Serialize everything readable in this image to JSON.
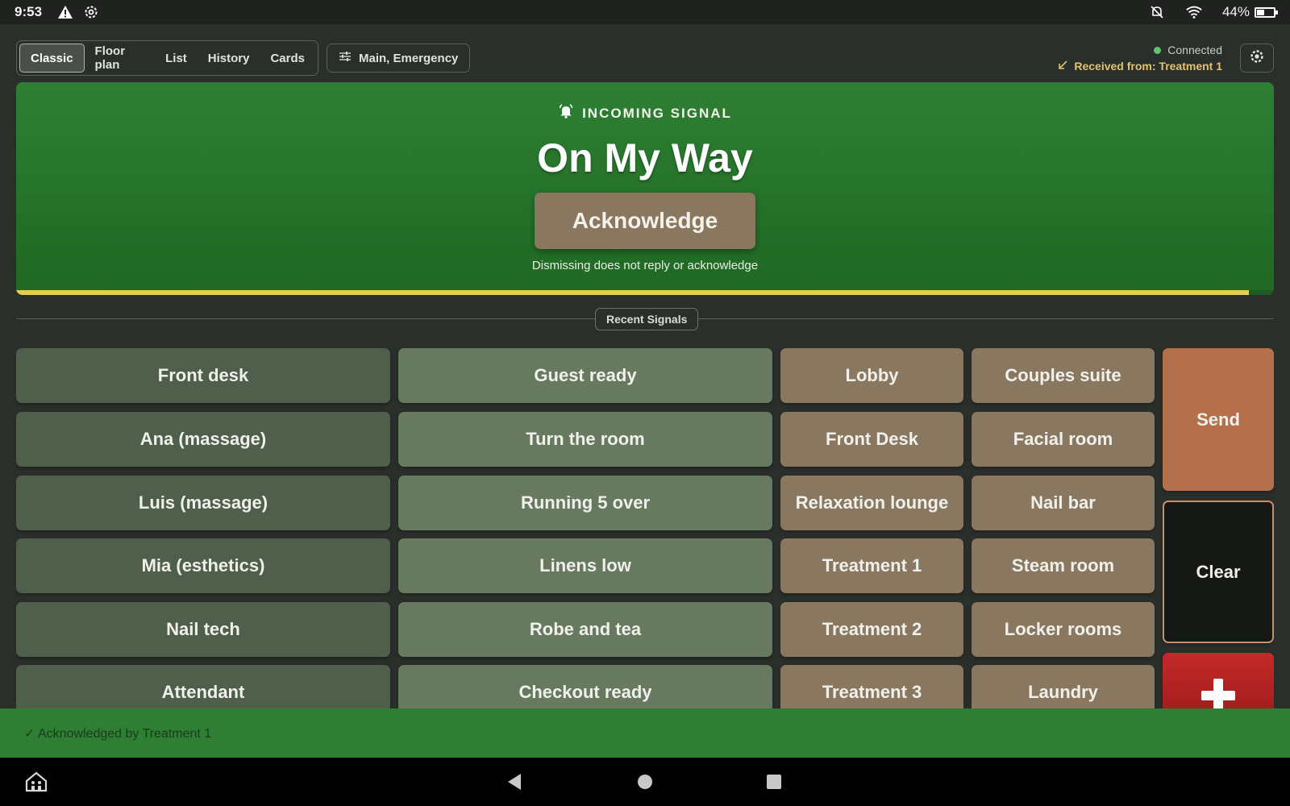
{
  "status_bar": {
    "time": "9:53",
    "battery": "44%",
    "battery_level": 0.44
  },
  "toolbar": {
    "tabs": [
      {
        "label": "Classic",
        "active": true
      },
      {
        "label": "Floor plan",
        "active": false
      },
      {
        "label": "List",
        "active": false
      },
      {
        "label": "History",
        "active": false
      },
      {
        "label": "Cards",
        "active": false
      }
    ],
    "filter_label": "Main, Emergency",
    "connection_status": "Connected",
    "received_from": "Received from: Treatment 1"
  },
  "banner": {
    "kicker": "INCOMING SIGNAL",
    "headline": "On My Way",
    "acknowledge_label": "Acknowledge",
    "note": "Dismissing does not reply or acknowledge",
    "progress": 0.98
  },
  "recent_signals_label": "Recent Signals",
  "grid": {
    "recipients": [
      "Front desk",
      "Ana (massage)",
      "Luis (massage)",
      "Mia (esthetics)",
      "Nail tech",
      "Attendant"
    ],
    "messages": [
      "Guest ready",
      "Turn the room",
      "Running 5 over",
      "Linens low",
      "Robe and tea",
      "Checkout ready"
    ],
    "locations_a": [
      "Lobby",
      "Front Desk",
      "Relaxation lounge",
      "Treatment 1",
      "Treatment 2",
      "Treatment 3"
    ],
    "locations_b": [
      "Couples suite",
      "Facial room",
      "Nail bar",
      "Steam room",
      "Locker rooms",
      "Laundry"
    ],
    "send_label": "Send",
    "clear_label": "Clear"
  },
  "toast": "✓ Acknowledged by Treatment 1",
  "colors": {
    "banner_green": "#2e7f33",
    "progress_yellow": "#e4cf53",
    "recipient_bg": "#4f5f4c",
    "message_bg": "#677a60",
    "location_bg": "#8a7760",
    "send_bg": "#b3704a",
    "emergency_red": "#c42a2a"
  },
  "icons": {
    "status": [
      "warning-icon",
      "gear-icon"
    ],
    "status_right": [
      "bell-off-icon",
      "wifi-icon",
      "battery-icon"
    ],
    "filter": "sliders-icon",
    "received": "arrow-down-left-icon",
    "settings": "gear-icon",
    "banner": "bell-ring-icon",
    "emergency": "plus-icon",
    "nav": [
      "home-app-icon",
      "back-icon",
      "home-icon",
      "recents-icon"
    ]
  }
}
